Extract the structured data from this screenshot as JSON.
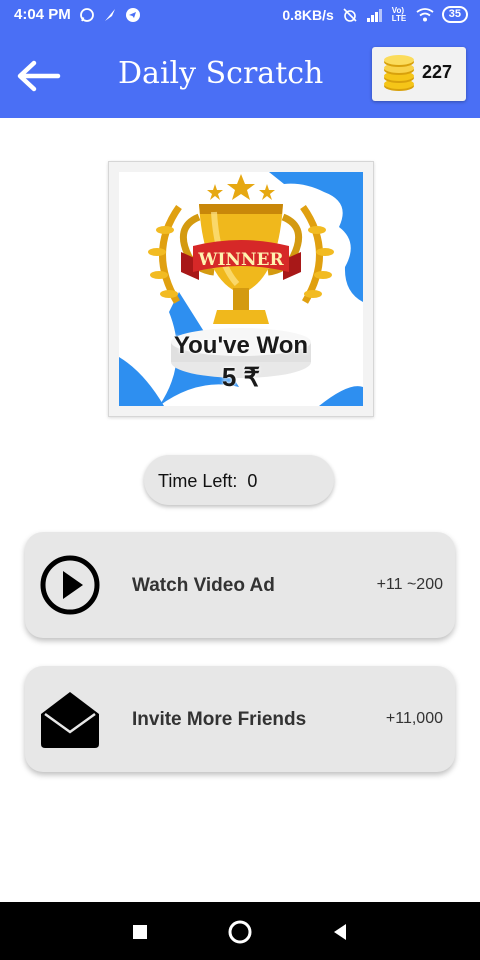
{
  "status_bar": {
    "time": "4:04 PM",
    "network_speed": "0.8KB/s",
    "battery": "35",
    "lte": "Vo) LTE"
  },
  "app_bar": {
    "title": "Daily Scratch",
    "coins": "227",
    "icons": [
      "back-arrow-icon",
      "coin-stack-icon"
    ]
  },
  "prize": {
    "badge_text": "WINNER",
    "line1": "You've Won",
    "line2": "5 ₹"
  },
  "timer": {
    "text": "Time Left:  0"
  },
  "actions": [
    {
      "label": "Watch Video Ad",
      "reward": "+11 ~200",
      "icon": "play-circle-icon"
    },
    {
      "label": "Invite More Friends",
      "reward": "+11,000",
      "icon": "envelope-open-icon"
    }
  ],
  "colors": {
    "app_bar": "#4a6ff5",
    "card_bg": "#e7e7e7",
    "nav_bar": "#000000"
  }
}
